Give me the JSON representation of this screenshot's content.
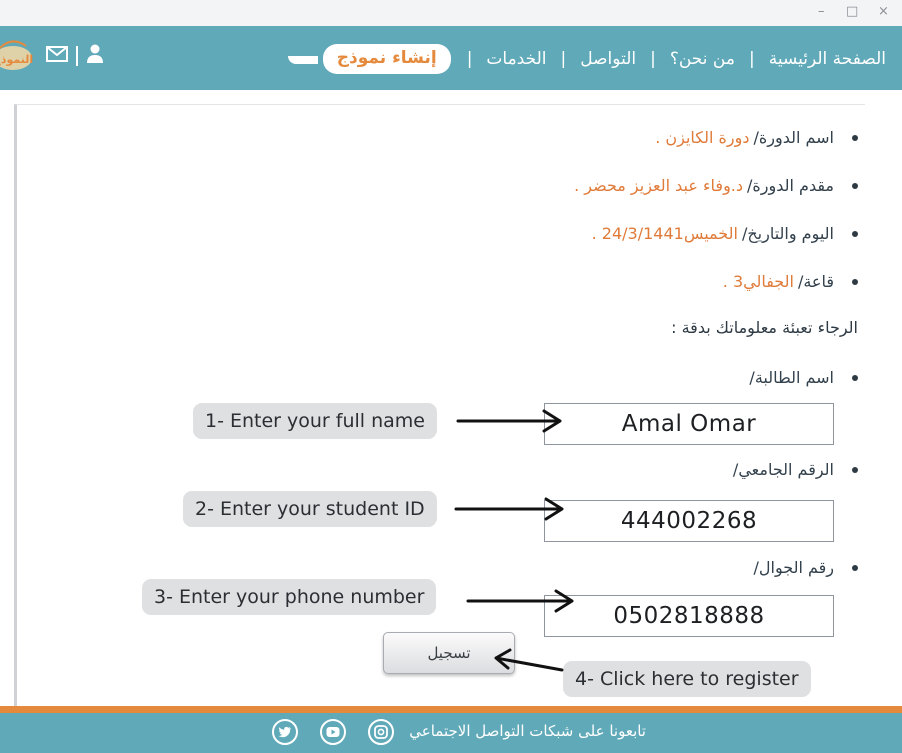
{
  "window": {
    "minimize_glyph": "–",
    "maximize_glyph": "□",
    "close_glyph": "×"
  },
  "nav": {
    "links": [
      "الصفحة الرئيسية",
      "من نحن؟",
      "التواصل",
      "الخدمات"
    ],
    "active": "إنشاء نموذج",
    "separator": "|",
    "logo_text": "النموذج",
    "icons": [
      "user-icon",
      "mail-icon"
    ]
  },
  "course": {
    "name_label": "اسم الدورة/",
    "name_value": "دورة الكايزن .",
    "presenter_label": "مقدم الدورة/",
    "presenter_value": "د.وفاء عبد العزيز محضر .",
    "date_label": "اليوم والتاريخ/",
    "date_value": "الخميس24/3/1441 .",
    "hall_label": "قاعة/",
    "hall_value": "الجفالي3 ."
  },
  "form": {
    "instruction": "الرجاء تعبئة معلوماتك بدقة :",
    "name_label": "اسم الطالبة/",
    "name_value": "Amal Omar",
    "id_label": "الرقم الجامعي/",
    "id_value": "444002268",
    "phone_label": "رقم الجوال/",
    "phone_value": "0502818888",
    "submit_label": "تسجيل"
  },
  "callouts": {
    "c1": "1- Enter your full name",
    "c2": "2- Enter your student ID",
    "c3": "3- Enter your phone number",
    "c4": "4- Click here to register"
  },
  "footer": {
    "text": "تابعونا على شبكات التواصل الاجتماعي",
    "icons": [
      "twitter-icon",
      "youtube-icon",
      "instagram-icon"
    ]
  },
  "colors": {
    "nav_bg": "#5fa9b8",
    "accent_orange": "#e58a3c",
    "value_orange": "#e07b3a",
    "callout_bg": "#dfe0e2"
  }
}
